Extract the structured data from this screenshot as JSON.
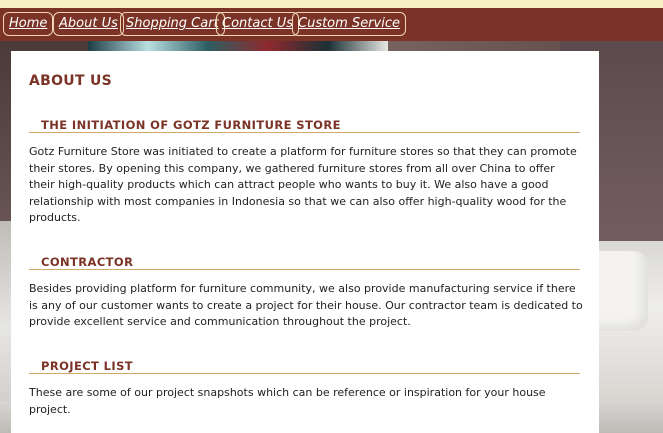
{
  "nav": {
    "items": [
      {
        "label": "Home"
      },
      {
        "label": "About Us"
      },
      {
        "label": "Shopping Cart"
      },
      {
        "label": "Contact Us"
      },
      {
        "label": "Custom Service"
      }
    ]
  },
  "page": {
    "title": "ABOUT US"
  },
  "sections": [
    {
      "heading": "THE INITIATION OF GOTZ FURNITURE STORE",
      "body": "Gotz Furniture Store was initiated to create a platform for furniture stores so that they can promote their stores. By opening this company, we gathered furniture stores from all over China to offer their high-quality products which can attract people who wants to buy it. We also have a good relationship with most companies in Indonesia so that we can also offer high-quality wood for the products."
    },
    {
      "heading": "CONTRACTOR",
      "body": "Besides providing platform for furniture community, we also provide manufacturing service if there is any of our customer wants to create a project for their house. Our contractor team is dedicated to provide excellent service and communication throughout the project."
    },
    {
      "heading": "PROJECT LIST",
      "body": "These are some of our project snapshots which can be reference or inspiration for your house project."
    }
  ],
  "colors": {
    "nav_background": "#7a3326",
    "heading": "#7a3326",
    "heading_rule": "#d2a86a",
    "top_strip": "#f7f0c6"
  }
}
